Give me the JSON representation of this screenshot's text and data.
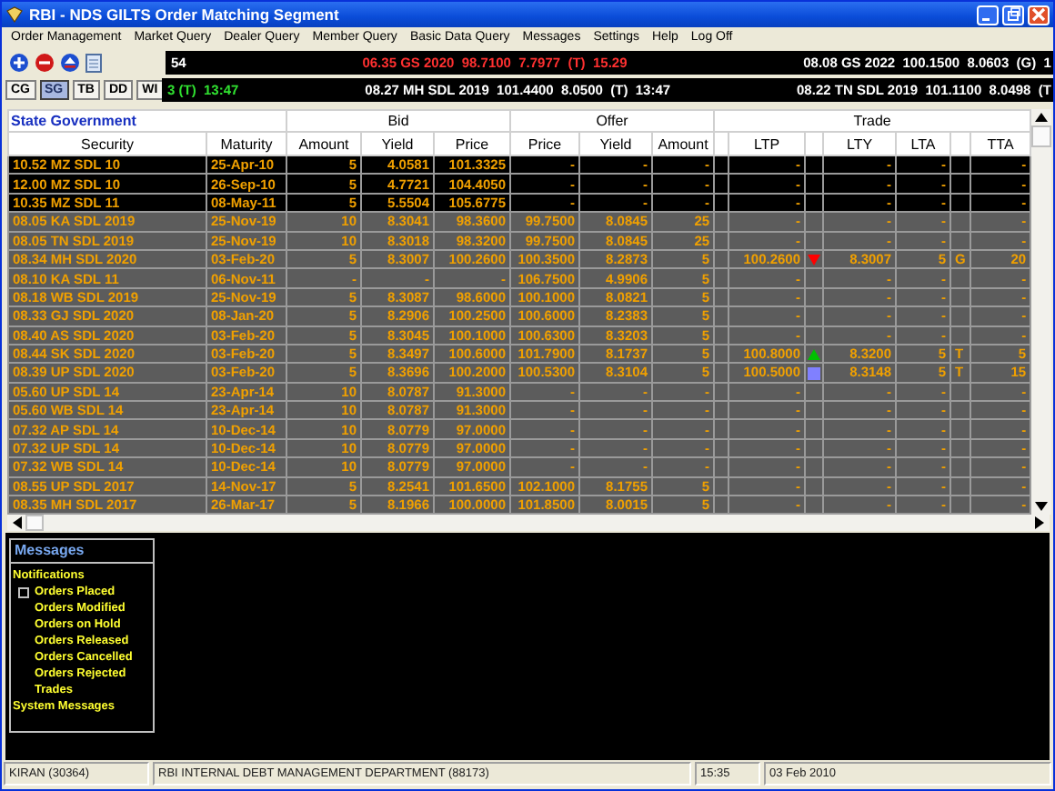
{
  "window": {
    "title": "RBI - NDS GILTS Order Matching Segment"
  },
  "menu": [
    "Order Management",
    "Market Query",
    "Dealer Query",
    "Member Query",
    "Basic Data Query",
    "Messages",
    "Settings",
    "Help",
    "Log Off"
  ],
  "ticker": [
    [
      {
        "text": "54",
        "color": "#ffffff"
      },
      {
        "text": "06.35 GS 2020  98.7100  7.7977  (T)  15.29",
        "color": "#ff3030"
      },
      {
        "text": "08.08 GS 2022  100.1500  8.0603  (G)  1",
        "color": "#ffffff"
      }
    ],
    [
      {
        "text": "3 (T)  13:47",
        "color": "#30e030"
      },
      {
        "text": "08.27 MH SDL 2019  101.4400  8.0500  (T)  13:47",
        "color": "#ffffff"
      },
      {
        "text": "08.22 TN SDL 2019  101.1100  8.0498  (T",
        "color": "#ffffff"
      }
    ]
  ],
  "tabs": [
    {
      "label": "CG",
      "selected": false
    },
    {
      "label": "SG",
      "selected": true
    },
    {
      "label": "TB",
      "selected": false
    },
    {
      "label": "DD",
      "selected": false
    },
    {
      "label": "WI",
      "selected": false
    }
  ],
  "table": {
    "title": "State Government",
    "groups": [
      "Bid",
      "Offer",
      "Trade"
    ],
    "columns": [
      "Security",
      "Maturity",
      "Amount",
      "Yield",
      "Price",
      "Price",
      "Yield",
      "Amount",
      "LTP",
      "LTY",
      "LTA",
      "TTA"
    ],
    "rows": [
      {
        "highlighted": true,
        "cells": [
          "10.52 MZ SDL 10",
          "25-Apr-10",
          "5",
          "4.0581",
          "101.3325",
          "-",
          "-",
          "-",
          "-",
          "-",
          "-",
          "-"
        ]
      },
      {
        "highlighted": true,
        "cells": [
          "12.00 MZ SDL 10",
          "26-Sep-10",
          "5",
          "4.7721",
          "104.4050",
          "-",
          "-",
          "-",
          "-",
          "-",
          "-",
          "-"
        ]
      },
      {
        "highlighted": true,
        "cells": [
          "10.35 MZ SDL 11",
          "08-May-11",
          "5",
          "5.5504",
          "105.6775",
          "-",
          "-",
          "-",
          "-",
          "-",
          "-",
          "-"
        ]
      },
      {
        "highlighted": false,
        "cells": [
          "08.05 KA SDL 2019",
          "25-Nov-19",
          "10",
          "8.3041",
          "98.3600",
          "99.7500",
          "8.0845",
          "25",
          "-",
          "-",
          "-",
          "-"
        ]
      },
      {
        "highlighted": false,
        "cells": [
          "08.05 TN SDL 2019",
          "25-Nov-19",
          "10",
          "8.3018",
          "98.3200",
          "99.7500",
          "8.0845",
          "25",
          "-",
          "-",
          "-",
          "-"
        ]
      },
      {
        "highlighted": false,
        "trend": {
          "kind": "down",
          "color": "#ff0000"
        },
        "flag": "G",
        "cells": [
          "08.34 MH SDL 2020",
          "03-Feb-20",
          "5",
          "8.3007",
          "100.2600",
          "100.3500",
          "8.2873",
          "5",
          "100.2600",
          "8.3007",
          "5",
          "20"
        ]
      },
      {
        "highlighted": false,
        "cells": [
          "08.10 KA SDL 11",
          "06-Nov-11",
          "-",
          "-",
          "-",
          "106.7500",
          "4.9906",
          "5",
          "-",
          "-",
          "-",
          "-"
        ]
      },
      {
        "highlighted": false,
        "cells": [
          "08.18 WB SDL 2019",
          "25-Nov-19",
          "5",
          "8.3087",
          "98.6000",
          "100.1000",
          "8.0821",
          "5",
          "-",
          "-",
          "-",
          "-"
        ]
      },
      {
        "highlighted": false,
        "cells": [
          "08.33 GJ SDL 2020",
          "08-Jan-20",
          "5",
          "8.2906",
          "100.2500",
          "100.6000",
          "8.2383",
          "5",
          "-",
          "-",
          "-",
          "-"
        ]
      },
      {
        "highlighted": false,
        "cells": [
          "08.40 AS SDL 2020",
          "03-Feb-20",
          "5",
          "8.3045",
          "100.1000",
          "100.6300",
          "8.3203",
          "5",
          "-",
          "-",
          "-",
          "-"
        ]
      },
      {
        "highlighted": false,
        "trend": {
          "kind": "up",
          "color": "#00c000"
        },
        "flag": "T",
        "cells": [
          "08.44 SK SDL 2020",
          "03-Feb-20",
          "5",
          "8.3497",
          "100.6000",
          "101.7900",
          "8.1737",
          "5",
          "100.8000",
          "8.3200",
          "5",
          "5"
        ]
      },
      {
        "highlighted": false,
        "trend": {
          "kind": "same",
          "color": "#8080ff"
        },
        "flag": "T",
        "cells": [
          "08.39 UP SDL 2020",
          "03-Feb-20",
          "5",
          "8.3696",
          "100.2000",
          "100.5300",
          "8.3104",
          "5",
          "100.5000",
          "8.3148",
          "5",
          "15"
        ]
      },
      {
        "highlighted": false,
        "cells": [
          "05.60 UP SDL 14",
          "23-Apr-14",
          "10",
          "8.0787",
          "91.3000",
          "-",
          "-",
          "-",
          "-",
          "-",
          "-",
          "-"
        ]
      },
      {
        "highlighted": false,
        "cells": [
          "05.60 WB SDL 14",
          "23-Apr-14",
          "10",
          "8.0787",
          "91.3000",
          "-",
          "-",
          "-",
          "-",
          "-",
          "-",
          "-"
        ]
      },
      {
        "highlighted": false,
        "cells": [
          "07.32 AP SDL 14",
          "10-Dec-14",
          "10",
          "8.0779",
          "97.0000",
          "-",
          "-",
          "-",
          "-",
          "-",
          "-",
          "-"
        ]
      },
      {
        "highlighted": false,
        "cells": [
          "07.32 UP SDL 14",
          "10-Dec-14",
          "10",
          "8.0779",
          "97.0000",
          "-",
          "-",
          "-",
          "-",
          "-",
          "-",
          "-"
        ]
      },
      {
        "highlighted": false,
        "cells": [
          "07.32 WB SDL 14",
          "10-Dec-14",
          "10",
          "8.0779",
          "97.0000",
          "-",
          "-",
          "-",
          "-",
          "-",
          "-",
          "-"
        ]
      },
      {
        "highlighted": false,
        "cells": [
          "08.55 UP SDL 2017",
          "14-Nov-17",
          "5",
          "8.2541",
          "101.6500",
          "102.1000",
          "8.1755",
          "5",
          "-",
          "-",
          "-",
          "-"
        ]
      },
      {
        "highlighted": false,
        "cells": [
          "08.35 MH SDL 2017",
          "26-Mar-17",
          "5",
          "8.1966",
          "100.0000",
          "101.8500",
          "8.0015",
          "5",
          "-",
          "-",
          "-",
          "-"
        ]
      }
    ]
  },
  "messages": {
    "title": "Messages",
    "items": [
      {
        "label": "Notifications",
        "children": [
          {
            "label": "Orders Placed",
            "selected": true
          },
          {
            "label": "Orders Modified",
            "selected": false
          },
          {
            "label": "Orders on Hold",
            "selected": false
          },
          {
            "label": "Orders Released",
            "selected": false
          },
          {
            "label": "Orders Cancelled",
            "selected": false
          },
          {
            "label": "Orders Rejected",
            "selected": false
          },
          {
            "label": "Trades",
            "selected": false
          }
        ]
      },
      {
        "label": "System Messages"
      }
    ]
  },
  "status_bar": [
    "KIRAN (30364)",
    "RBI INTERNAL DEBT MANAGEMENT DEPARTMENT (88173)",
    "15:35",
    "03 Feb 2010"
  ]
}
